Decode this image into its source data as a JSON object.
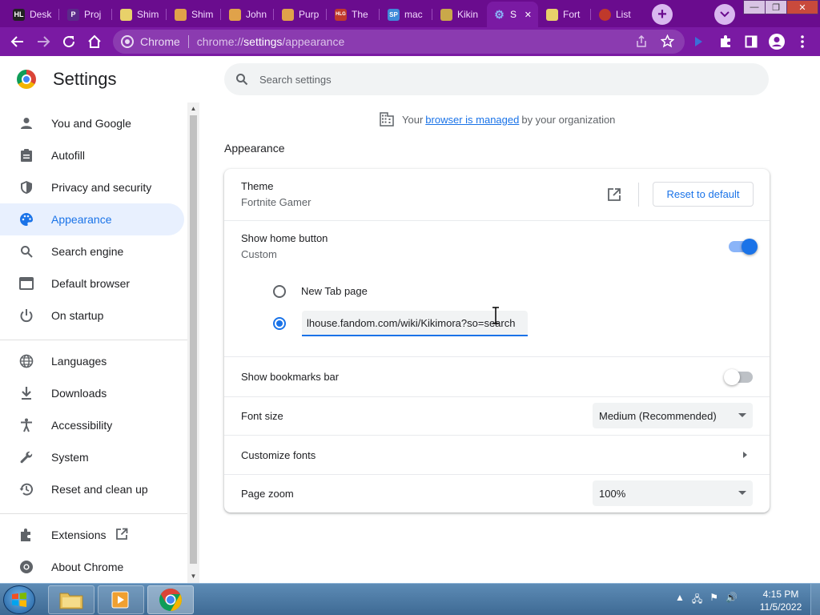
{
  "tabs": [
    {
      "title": "Desk",
      "favicon_color": "#222222",
      "favicon_text": "HL"
    },
    {
      "title": "Proj",
      "favicon_color": "#5b2a8a",
      "favicon_text": "P"
    },
    {
      "title": "Shim",
      "favicon_color": "#e8d16a",
      "favicon_text": ""
    },
    {
      "title": "Shim",
      "favicon_color": "#e0a24a",
      "favicon_text": ""
    },
    {
      "title": "John",
      "favicon_color": "#e0a24a",
      "favicon_text": ""
    },
    {
      "title": "Purp",
      "favicon_color": "#e0a24a",
      "favicon_text": ""
    },
    {
      "title": "The",
      "favicon_color": "#c0392b",
      "favicon_text": "HLG"
    },
    {
      "title": "mac",
      "favicon_color": "#3f8ad8",
      "favicon_text": "SP"
    },
    {
      "title": "Kikin",
      "favicon_color": "#c9a84a",
      "favicon_text": ""
    },
    {
      "title": "S",
      "favicon_color": "#1a73e8",
      "favicon_text": "⚙",
      "active": true
    },
    {
      "title": "Fort",
      "favicon_color": "#e8d16a",
      "favicon_text": ""
    },
    {
      "title": "List",
      "favicon_color": "#c0392b",
      "favicon_text": ""
    }
  ],
  "window": {
    "minimize": "—",
    "maximize": "❐",
    "close": "✕"
  },
  "toolbar": {
    "chip_label": "Chrome",
    "url_prefix": "chrome://",
    "url_path": "settings",
    "url_rest": "/appearance"
  },
  "header": {
    "title": "Settings",
    "search_placeholder": "Search settings"
  },
  "sidebar": {
    "items": [
      {
        "label": "You and Google",
        "icon": "person-icon"
      },
      {
        "label": "Autofill",
        "icon": "clipboard-icon"
      },
      {
        "label": "Privacy and security",
        "icon": "shield-icon"
      },
      {
        "label": "Appearance",
        "icon": "palette-icon",
        "active": true
      },
      {
        "label": "Search engine",
        "icon": "search-icon"
      },
      {
        "label": "Default browser",
        "icon": "browser-icon"
      },
      {
        "label": "On startup",
        "icon": "power-icon"
      },
      {
        "label": "Languages",
        "icon": "globe-icon"
      },
      {
        "label": "Downloads",
        "icon": "download-icon"
      },
      {
        "label": "Accessibility",
        "icon": "accessibility-icon"
      },
      {
        "label": "System",
        "icon": "wrench-icon"
      },
      {
        "label": "Reset and clean up",
        "icon": "history-icon"
      },
      {
        "label": "Extensions",
        "icon": "puzzle-icon"
      },
      {
        "label": "About Chrome",
        "icon": "chrome-icon"
      }
    ]
  },
  "managed": {
    "prefix": "Your",
    "link": "browser is managed",
    "suffix": "by your organization"
  },
  "appearance": {
    "section_title": "Appearance",
    "theme_label": "Theme",
    "theme_value": "Fortnite Gamer",
    "reset_label": "Reset to default",
    "home_button_label": "Show home button",
    "home_button_value": "Custom",
    "home_button_on": true,
    "newtab_option": "New Tab page",
    "custom_url": "lhouse.fandom.com/wiki/Kikimora?so=search",
    "bookmarks_label": "Show bookmarks bar",
    "bookmarks_on": false,
    "font_size_label": "Font size",
    "font_size_value": "Medium (Recommended)",
    "customize_fonts_label": "Customize fonts",
    "page_zoom_label": "Page zoom",
    "page_zoom_value": "100%"
  },
  "taskbar": {
    "time": "4:15 PM",
    "date": "11/5/2022"
  }
}
